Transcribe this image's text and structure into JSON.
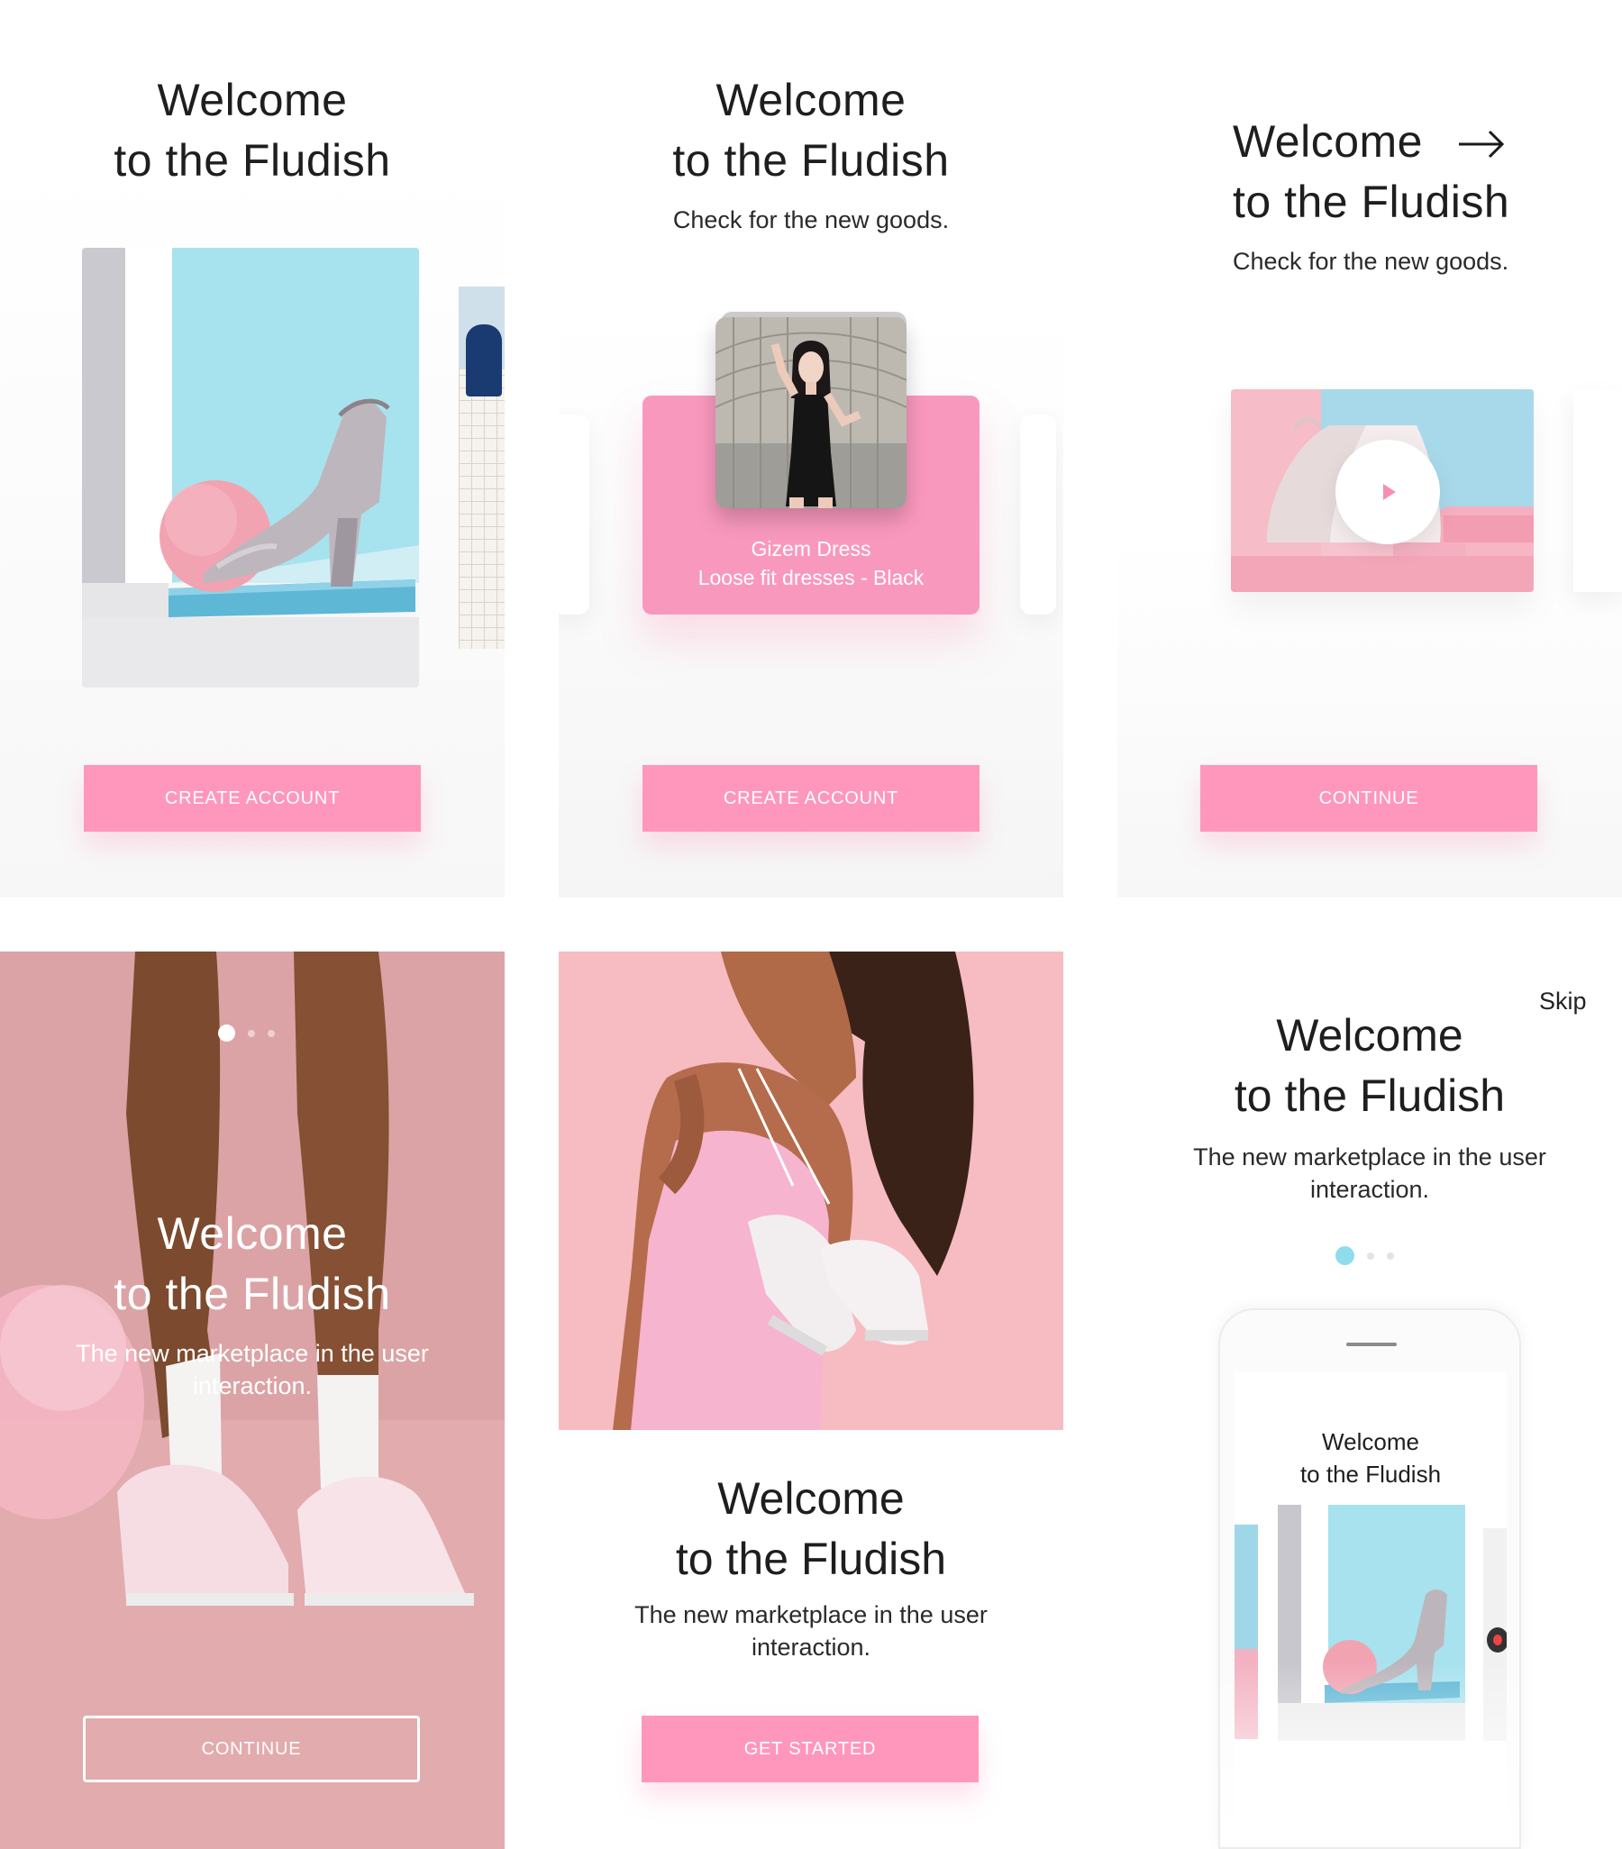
{
  "screen1": {
    "title_line1": "Welcome",
    "title_line2": "to the Fludish",
    "button": "CREATE ACCOUNT"
  },
  "screen2": {
    "title_line1": "Welcome",
    "title_line2": "to the Fludish",
    "subtitle": "Check for the new goods.",
    "product_name": "Gizem Dress",
    "product_desc": "Loose fit dresses - Black",
    "button": "CREATE ACCOUNT"
  },
  "screen3": {
    "title_line1": "Welcome",
    "title_line2": "to the Fludish",
    "subtitle": "Check for the new goods.",
    "button": "CONTINUE",
    "arrow_icon": "arrow-right-icon",
    "play_icon": "play-icon"
  },
  "screen4": {
    "title_line1": "Welcome",
    "title_line2": "to the Fludish",
    "subtitle_line1": "The new marketplace in the user",
    "subtitle_line2": "interaction.",
    "button": "CONTINUE",
    "pager": {
      "count": 3,
      "active": 0
    }
  },
  "screen5": {
    "title_line1": "Welcome",
    "title_line2": "to the Fludish",
    "subtitle_line1": "The new marketplace in the user",
    "subtitle_line2": "interaction.",
    "button": "GET STARTED"
  },
  "screen6": {
    "skip": "Skip",
    "title_line1": "Welcome",
    "title_line2": "to the Fludish",
    "subtitle_line1": "The new marketplace in the user",
    "subtitle_line2": "interaction.",
    "pager": {
      "count": 3,
      "active": 0
    },
    "phone_title_line1": "Welcome",
    "phone_title_line2": "to the Fludish"
  },
  "colors": {
    "accent_pink": "#ff97bd",
    "card_pink": "#f998bd",
    "dusty_pink": "#d9a2a4",
    "pager_blue": "#8fdcec"
  }
}
